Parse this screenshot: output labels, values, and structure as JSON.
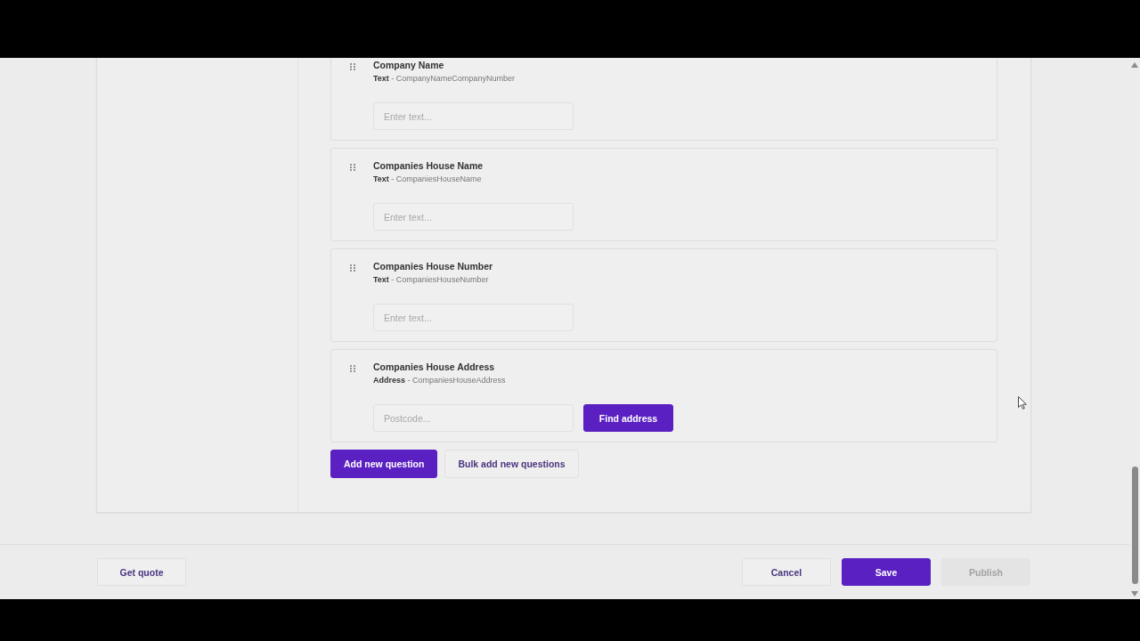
{
  "questions": [
    {
      "title": "Company Name",
      "subtitle": "**Text** - CompanyNameCompanyNumber",
      "input": {
        "placeholder": "Enter text..."
      }
    },
    {
      "title": "Companies House Name",
      "subtitle": "**Text** - CompaniesHouseName",
      "input": {
        "placeholder": "Enter text..."
      }
    },
    {
      "title": "Companies House Number",
      "subtitle": "**Text** - CompaniesHouseNumber",
      "input": {
        "placeholder": "Enter text..."
      }
    },
    {
      "title": "Companies House Address",
      "subtitle": "**Address** - CompaniesHouseAddress",
      "input": {
        "placeholder": "Postcode..."
      },
      "button": "Find address"
    }
  ],
  "question_actions": [
    {
      "label": "Add new question",
      "kind": "primary"
    },
    {
      "label": "Bulk add new questions",
      "kind": "secondary"
    }
  ],
  "footer": {
    "left": [
      {
        "label": "Get quote",
        "kind": "secondary",
        "disabled": false
      }
    ],
    "right": [
      {
        "label": "Cancel",
        "kind": "secondary",
        "disabled": false
      },
      {
        "label": "Save",
        "kind": "primary",
        "disabled": false
      },
      {
        "label": "Publish",
        "kind": "secondary",
        "disabled": true
      }
    ]
  }
}
